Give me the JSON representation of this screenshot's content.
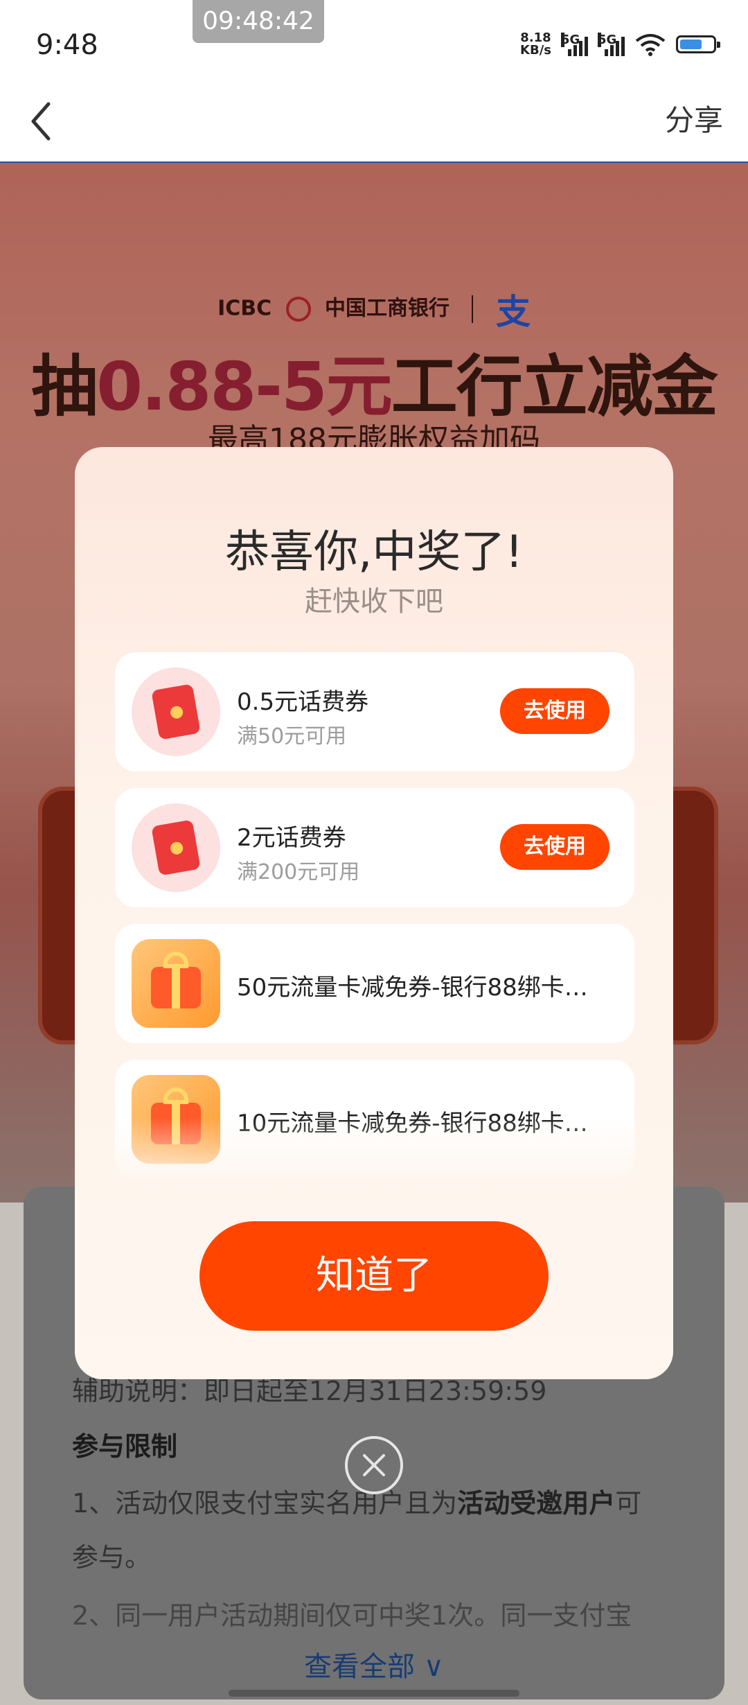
{
  "status_bar": {
    "time": "9:48",
    "recording_time": "09:48:42",
    "net_speed_value": "8.18",
    "net_speed_unit": "KB/s",
    "sim1": "5G",
    "sim2": "5G",
    "battery_level": 0.7
  },
  "nav": {
    "share_label": "分享"
  },
  "banner": {
    "brand_en": "ICBC",
    "brand_cn": "中国工商银行",
    "alipay_mark": "支",
    "title_prefix": "抽",
    "title_highlight": "0.88-5元",
    "title_suffix": "工行立减金",
    "subtitle": "最高188元膨胀权益加码"
  },
  "dialog": {
    "title": "恭喜你,中奖了!",
    "subtitle": "赶快收下吧",
    "prizes": [
      {
        "name": "0.5元话费券",
        "condition": "满50元可用",
        "action": "去使用",
        "icon": "red-envelope-icon"
      },
      {
        "name": "2元话费券",
        "condition": "满200元可用",
        "action": "去使用",
        "icon": "red-envelope-icon"
      },
      {
        "name": "50元流量卡减免券-银行88绑卡…",
        "icon": "gift-box-icon"
      },
      {
        "name": "10元流量卡减免券-银行88绑卡…",
        "icon": "gift-box-icon"
      }
    ],
    "ok_label": "知道了"
  },
  "rules": {
    "line_time": "辅助说明：即日起至12月31日23:59:59",
    "heading": "参与限制",
    "rule1_a": "1、活动仅限支付宝实名用户且为",
    "rule1_bold": "活动受邀用户",
    "rule1_b": "可",
    "rule1_c": "参与。",
    "rule2": "2、同一用户活动期间仅可中奖1次。同一支付宝",
    "see_all": "查看全部"
  },
  "colors": {
    "accent": "#ff4500",
    "link": "#1e4a8c"
  }
}
